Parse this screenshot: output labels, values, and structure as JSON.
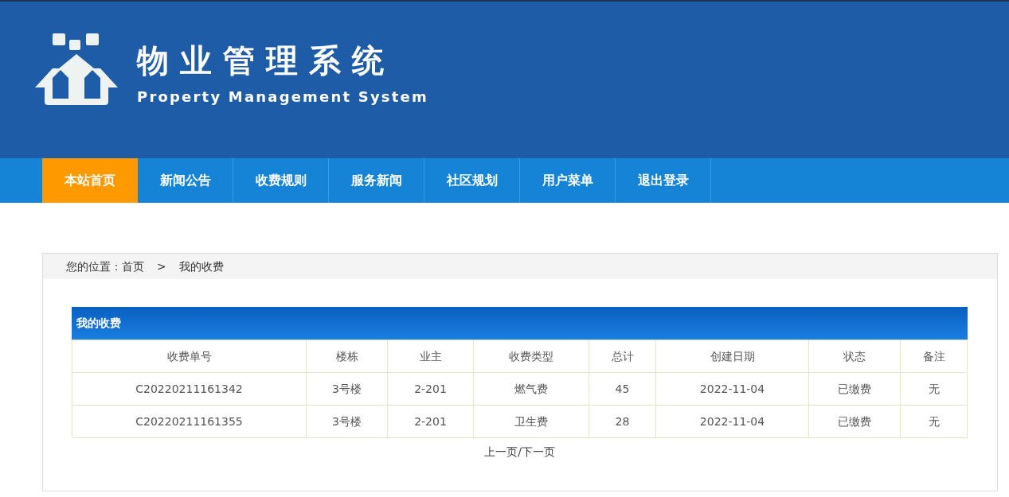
{
  "header": {
    "title": "物业管理系统",
    "subtitle": "Property Management System"
  },
  "nav": [
    {
      "label": "本站首页",
      "selected": true
    },
    {
      "label": "新闻公告",
      "selected": false
    },
    {
      "label": "收费规则",
      "selected": false
    },
    {
      "label": "服务新闻",
      "selected": false
    },
    {
      "label": "社区规划",
      "selected": false
    },
    {
      "label": "用户菜单",
      "selected": false
    },
    {
      "label": "退出登录",
      "selected": false
    }
  ],
  "breadcrumb": {
    "prefix": "您的位置：",
    "items": [
      "首页",
      "我的收费"
    ],
    "separator": ">"
  },
  "table": {
    "title": "我的收费",
    "columns": [
      "收费单号",
      "楼栋",
      "业主",
      "收费类型",
      "总计",
      "创建日期",
      "状态",
      "备注"
    ],
    "rows": [
      [
        "C20220211161342",
        "3号楼",
        "2-201",
        "燃气费",
        "45",
        "2022-11-04",
        "已缴费",
        "无"
      ],
      [
        "C20220211161355",
        "3号楼",
        "2-201",
        "卫生费",
        "28",
        "2022-11-04",
        "已缴费",
        "无"
      ]
    ]
  },
  "pagination": {
    "prev": "上一页",
    "separator": "/",
    "next": "下一页"
  }
}
